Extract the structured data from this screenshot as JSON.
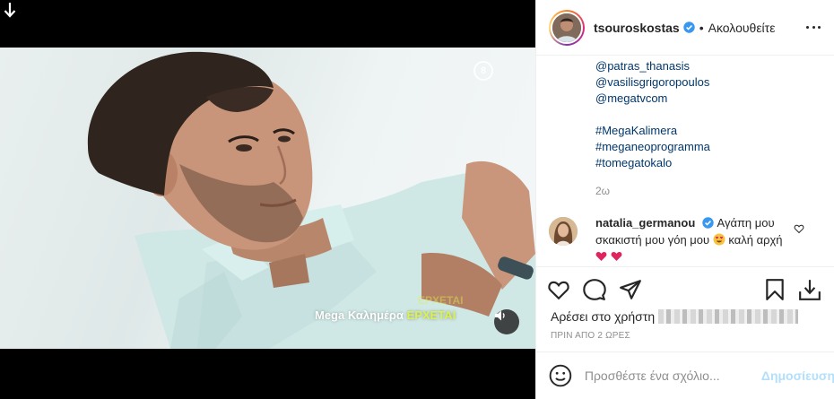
{
  "author": {
    "username": "tsouroskostas",
    "follow_state": "Ακολουθείτε",
    "separator": "•"
  },
  "video": {
    "overlay_caption": "Mega Καλημέρα",
    "overlay_highlight": "ΕΡΧΕΤΑΙ",
    "overlay_ghost": "ΕΡΧΕΤΑΙ",
    "watermark": "8",
    "sound_state": "on"
  },
  "caption": {
    "mentions": [
      "@patras_thanasis",
      "@vasilisgrigoropoulos",
      "@megatvcom"
    ],
    "hashtags": [
      "#MegaKalimera",
      "#meganeoprogramma",
      "#tomegatokalo"
    ],
    "age": "2ω"
  },
  "comment": {
    "username": "natalia_germanou",
    "text_part1": "Αγάπη μου σκακιστή μου γόη μου",
    "text_part2": "καλή αρχή"
  },
  "likes": {
    "prefix": "Αρέσει στο χρήστη"
  },
  "timestamp": "ΠΡΙΝ ΑΠΟ 2 ΩΡΕΣ",
  "comment_box": {
    "placeholder": "Προσθέστε ένα σχόλιο...",
    "post_label": "Δημοσίευση"
  },
  "colors": {
    "verified": "#3897f0",
    "link": "#00376b",
    "post_disabled": "#b2dffc",
    "heart_red": "#ed4956",
    "overlay_highlight": "#dcf24a"
  },
  "icons": [
    "download-arrow-icon",
    "speaker-icon",
    "verified-icon",
    "more-options-icon",
    "heart-icon",
    "comment-icon",
    "share-icon",
    "save-icon",
    "download-icon",
    "emoji-icon"
  ]
}
